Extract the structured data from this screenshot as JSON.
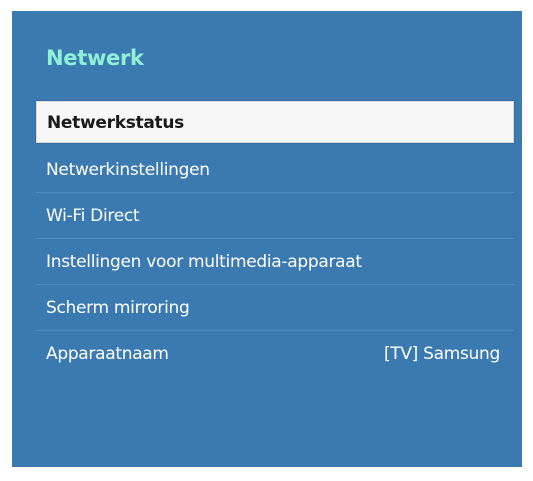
{
  "menu": {
    "title": "Netwerk",
    "items": [
      {
        "label": "Netwerkstatus",
        "selected": true
      },
      {
        "label": "Netwerkinstellingen"
      },
      {
        "label": "Wi-Fi Direct"
      },
      {
        "label": "Instellingen voor multimedia-apparaat"
      },
      {
        "label": "Scherm mirroring"
      },
      {
        "label": "Apparaatnaam",
        "value": "[TV] Samsung"
      }
    ]
  },
  "colors": {
    "panel_background": "#3b7ab0",
    "title_color": "#8ff0d6",
    "selected_background": "#f7f7f7"
  }
}
